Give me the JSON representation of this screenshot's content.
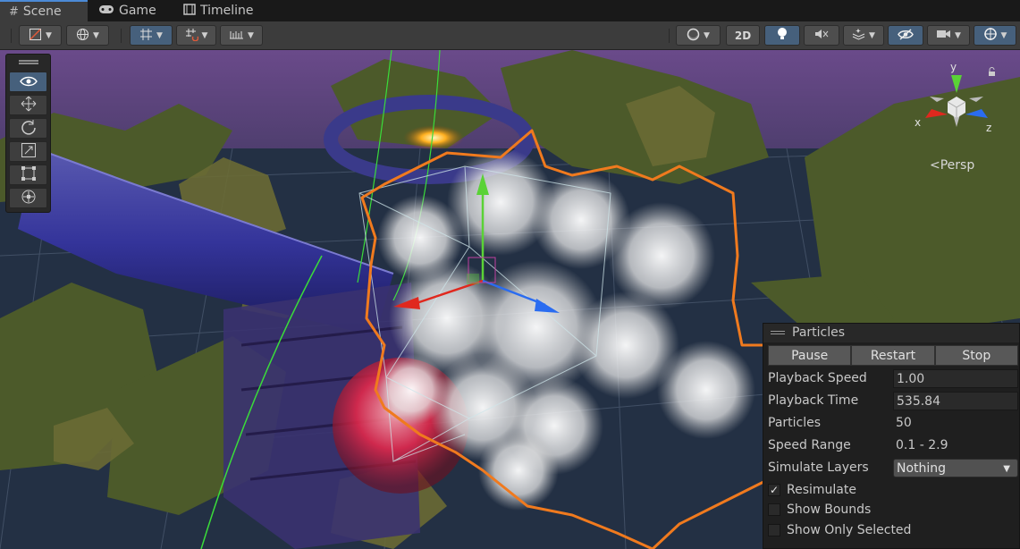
{
  "tabs": [
    {
      "label": "Scene",
      "icon": "grid-icon"
    },
    {
      "label": "Game",
      "icon": "gamepad-icon"
    },
    {
      "label": "Timeline",
      "icon": "film-icon"
    }
  ],
  "toolbar": {
    "mode_2d_label": "2D"
  },
  "tool_palette": [
    "view-tool",
    "move-tool",
    "rotate-tool",
    "scale-tool",
    "rect-tool",
    "transform-tool"
  ],
  "gizmo": {
    "x_label": "x",
    "y_label": "y",
    "z_label": "z",
    "projection_label": "Persp"
  },
  "particles_panel": {
    "title": "Particles",
    "pause_label": "Pause",
    "restart_label": "Restart",
    "stop_label": "Stop",
    "playback_speed_label": "Playback Speed",
    "playback_speed_value": "1.00",
    "playback_time_label": "Playback Time",
    "playback_time_value": "535.84",
    "particles_label": "Particles",
    "particles_value": "50",
    "speed_range_label": "Speed Range",
    "speed_range_value": "0.1 - 2.9",
    "simulate_layers_label": "Simulate Layers",
    "simulate_layers_value": "Nothing",
    "resimulate_label": "Resimulate",
    "resimulate_checked": true,
    "show_bounds_label": "Show Bounds",
    "show_bounds_checked": false,
    "show_only_selected_label": "Show Only Selected",
    "show_only_selected_checked": false
  },
  "colors": {
    "selection_outline": "#f07a1e",
    "axis_x": "#e0281e",
    "axis_y": "#5ad236",
    "axis_z": "#2a6cf0",
    "sky": "#6a4a8a"
  }
}
